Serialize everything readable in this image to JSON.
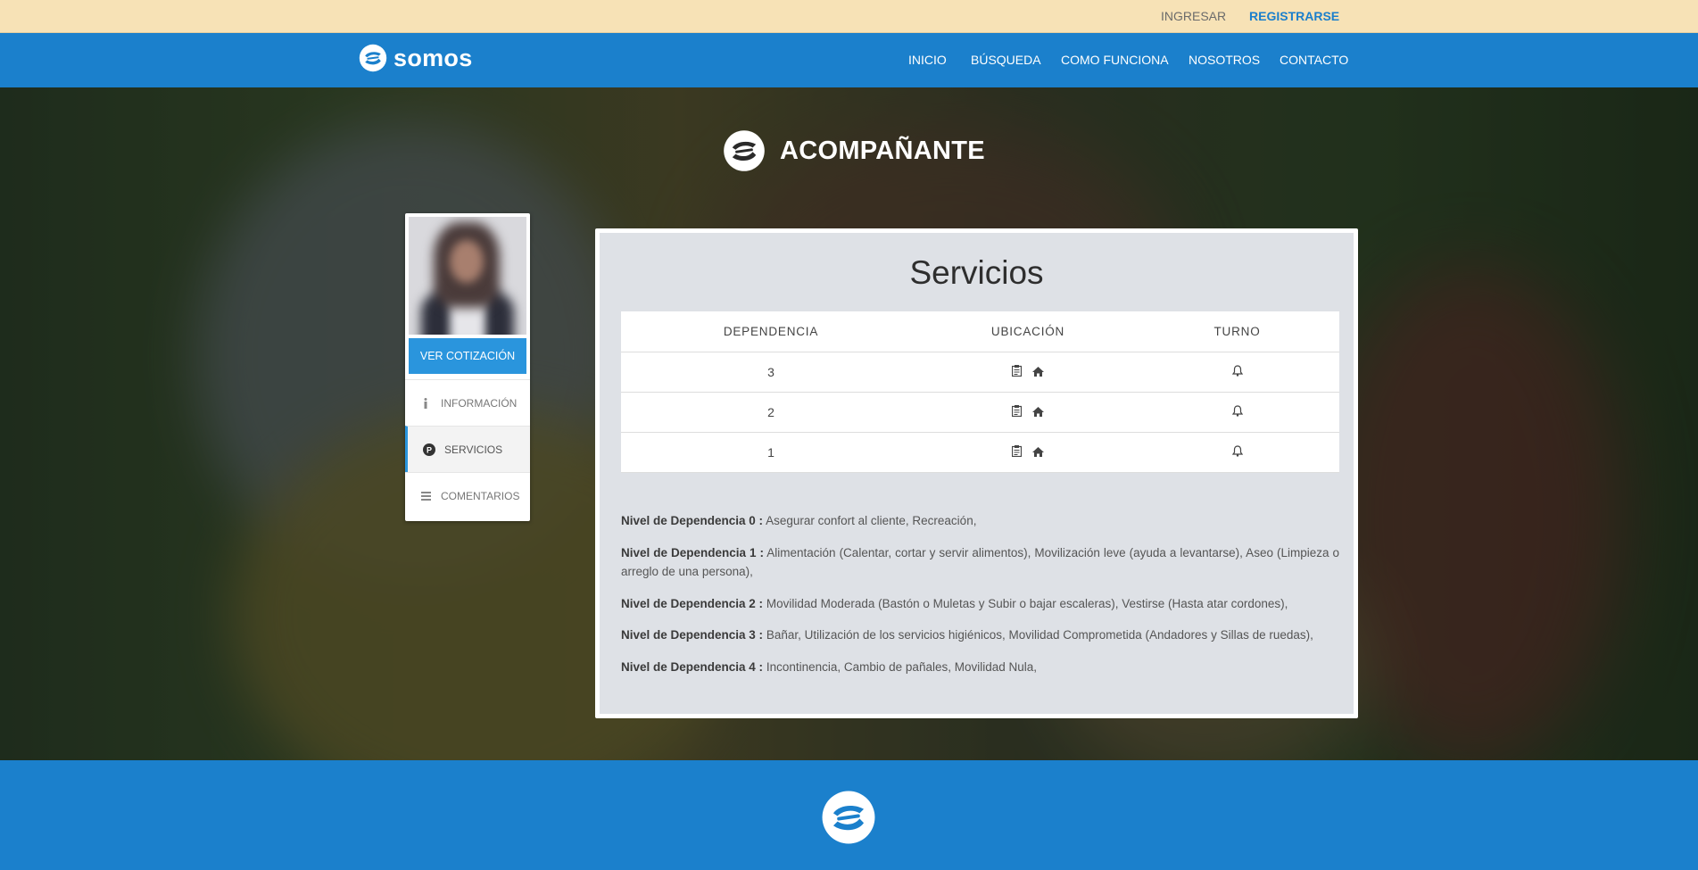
{
  "topbar": {
    "login": "INGRESAR",
    "register": "REGISTRARSE"
  },
  "nav": {
    "brand": "somos",
    "items": [
      "INICIO",
      "BÚSQUEDA",
      "COMO FUNCIONA",
      "NOSOTROS",
      "CONTACTO"
    ]
  },
  "hero": {
    "title": "ACOMPAÑANTE"
  },
  "profile": {
    "quote_button": "VER COTIZACIÓN",
    "menu": [
      {
        "label": "INFORMACIÓN",
        "icon": "info-icon"
      },
      {
        "label": "SERVICIOS",
        "icon": "parking-icon"
      },
      {
        "label": "COMENTARIOS",
        "icon": "list-icon"
      }
    ]
  },
  "services": {
    "title": "Servicios",
    "headers": [
      "DEPENDENCIA",
      "UBICACIÓN",
      "TURNO"
    ],
    "rows": [
      {
        "dependencia": "3",
        "ubicacion": [
          "clipboard-icon",
          "home-icon"
        ],
        "turno": "bell-icon"
      },
      {
        "dependencia": "2",
        "ubicacion": [
          "clipboard-icon",
          "home-icon"
        ],
        "turno": "bell-icon"
      },
      {
        "dependencia": "1",
        "ubicacion": [
          "clipboard-icon",
          "home-icon"
        ],
        "turno": "bell-icon"
      }
    ],
    "levels": [
      {
        "label": "Nivel de Dependencia 0 :",
        "text": "Asegurar confort al cliente, Recreación,"
      },
      {
        "label": "Nivel de Dependencia 1 :",
        "text": "Alimentación (Calentar, cortar y servir alimentos), Movilización leve (ayuda a levantarse), Aseo (Limpieza o arreglo de una persona),"
      },
      {
        "label": "Nivel de Dependencia 2 :",
        "text": "Movilidad Moderada (Bastón o Muletas y Subir o bajar escaleras), Vestirse (Hasta atar cordones),"
      },
      {
        "label": "Nivel de Dependencia 3 :",
        "text": "Bañar, Utilización de los servicios higiénicos, Movilidad Comprometida (Andadores y Sillas de ruedas),"
      },
      {
        "label": "Nivel de Dependencia 4 :",
        "text": "Incontinencia, Cambio de pañales, Movilidad Nula,"
      }
    ]
  },
  "colors": {
    "brand_blue": "#1b80cc",
    "button_blue": "#2a95dd",
    "topbar": "#f7e2b6",
    "panel": "#dee1e6"
  }
}
